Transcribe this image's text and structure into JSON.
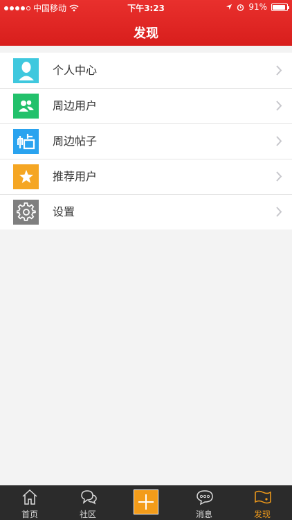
{
  "status_bar": {
    "carrier": "中国移动",
    "time": "下午3:23",
    "battery": "91%",
    "battery_level": 0.91
  },
  "header": {
    "title": "发现"
  },
  "menu": [
    {
      "label": "个人中心",
      "icon": "person-icon",
      "color": "#3fc8de"
    },
    {
      "label": "周边用户",
      "icon": "users-icon",
      "color": "#22c16b"
    },
    {
      "label": "周边帖子",
      "icon": "post-icon",
      "color": "#2aa3ef"
    },
    {
      "label": "推荐用户",
      "icon": "star-icon",
      "color": "#f5a623"
    },
    {
      "label": "设置",
      "icon": "gear-icon",
      "color": "#7f7f7f"
    }
  ],
  "tabbar": [
    {
      "label": "首页",
      "icon": "home-icon"
    },
    {
      "label": "社区",
      "icon": "chat-icon"
    },
    {
      "label": "",
      "icon": "plus-icon"
    },
    {
      "label": "消息",
      "icon": "message-icon"
    },
    {
      "label": "发现",
      "icon": "discover-icon",
      "active": true
    }
  ],
  "colors": {
    "header": "#e0262a",
    "accent": "#f39c1a"
  }
}
